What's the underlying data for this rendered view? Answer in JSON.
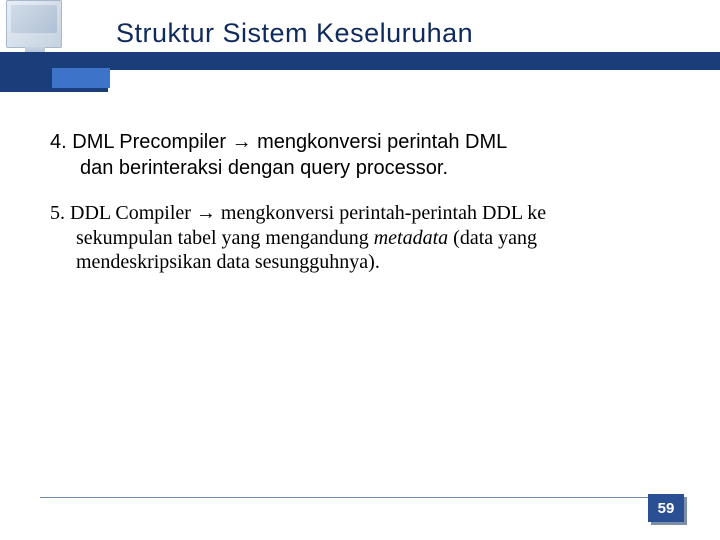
{
  "header": {
    "title": "Struktur Sistem Keseluruhan"
  },
  "items": [
    {
      "num": "4.",
      "lead": "DML Precompiler",
      "arrow": "→",
      "tail_line1": "mengkonversi perintah DML",
      "tail_line2": "dan berinteraksi dengan query processor."
    },
    {
      "num": "5.",
      "lead": "DDL Compiler",
      "arrow": "→",
      "tail_line1": "mengkonversi perintah-perintah DDL ke",
      "tail_line2a": "sekumpulan tabel yang mengandung ",
      "tail_line2_italic": "metadata",
      "tail_line2b": " (data yang",
      "tail_line3": "mendeskripsikan data sesungguhnya)."
    }
  ],
  "page_number": "59"
}
